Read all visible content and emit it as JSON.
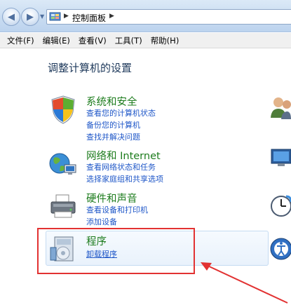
{
  "address_bar": {
    "crumb": "控制面板"
  },
  "menu": [
    "文件(F)",
    "编辑(E)",
    "查看(V)",
    "工具(T)",
    "帮助(H)"
  ],
  "heading": "调整计算机的设置",
  "categories": [
    {
      "title": "系统和安全",
      "links": [
        "查看您的计算机状态",
        "备份您的计算机",
        "查找并解决问题"
      ]
    },
    {
      "title": "网络和 Internet",
      "links": [
        "查看网络状态和任务",
        "选择家庭组和共享选项"
      ]
    },
    {
      "title": "硬件和声音",
      "links": [
        "查看设备和打印机",
        "添加设备"
      ]
    },
    {
      "title": "程序",
      "links": [
        "卸载程序"
      ]
    }
  ],
  "colors": {
    "category_title": "#1d7c1d",
    "link": "#1f57c8",
    "heading": "#1e395b",
    "annotation": "#e23232"
  }
}
